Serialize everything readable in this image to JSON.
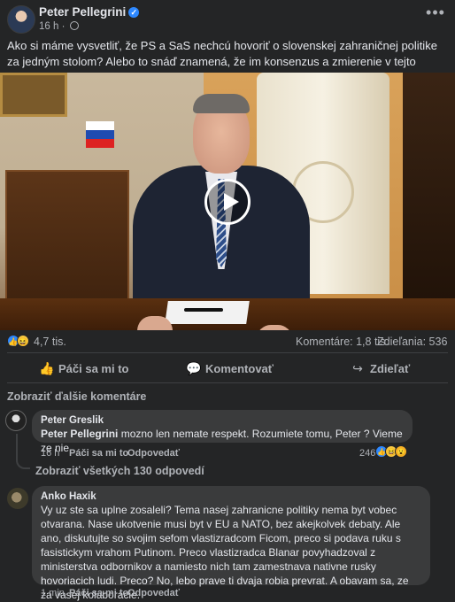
{
  "post": {
    "author": "Peter Pellegrini",
    "time": "16 h",
    "text": "Ako si máme vysvetliť, že PS a SaS nechcú hovoriť o slovenskej zahraničnej politike za jedným stolom? Alebo to snáď znamená, že im konsenzus a zmierenie v tejto kľúčovej téme nevyhovuje?",
    "more_glyph": "•••",
    "close_glyph": "✕"
  },
  "stats": {
    "reactions": "4,7 tis.",
    "comments": "Komentáre: 1,8 tis.",
    "shares": "Zdieľania: 536"
  },
  "actions": {
    "like": "Páči sa mi to",
    "comment": "Komentovať",
    "share": "Zdieľať"
  },
  "comments_section": {
    "show_more": "Zobraziť ďalšie komentáre",
    "comments": [
      {
        "author": "Peter Greslik",
        "mention": "Peter Pellegrini",
        "text": " mozno len nemate respekt. Rozumiete tomu, Peter ? Vieme ze nie",
        "time": "16 h",
        "like": "Páči sa mi to",
        "reply": "Odpovedať",
        "reaction_count": "246",
        "view_replies": "Zobraziť všetkých 130 odpovedí"
      },
      {
        "author": "Anko Haxik",
        "text": "Vy uz ste sa uplne zosaleli? Tema nasej zahranicne politiky nema byt vobec otvarana. Nase ukotvenie musi byt v EU a NATO, bez akejkolvek debaty. Ale ano, diskutujte so svojim sefom vlastizradcom Ficom, preco si podava ruku s fasistickym vrahom Putinom. Preco vlastizradca Blanar povyhadzoval z ministerstva odbornikov a namiesto nich tam zamestnava nativne rusky hovoriacich ludi. Preco? No, lebo prave ti dvaja robia prevrat. A obavam sa, ze za vasej kolaboracie.",
        "time": "1 min",
        "like": "Páči sa mi to",
        "reply": "Odpovedať"
      }
    ]
  },
  "icons": {
    "verified": "verified-badge-icon",
    "like": "thumbs-up-icon",
    "comment": "speech-bubble-icon",
    "share": "share-arrow-icon",
    "play": "play-icon"
  },
  "colors": {
    "background": "#242526",
    "bubble": "#3a3b3c",
    "accent": "#2d88ff",
    "secondary_text": "#b0b3b8"
  }
}
